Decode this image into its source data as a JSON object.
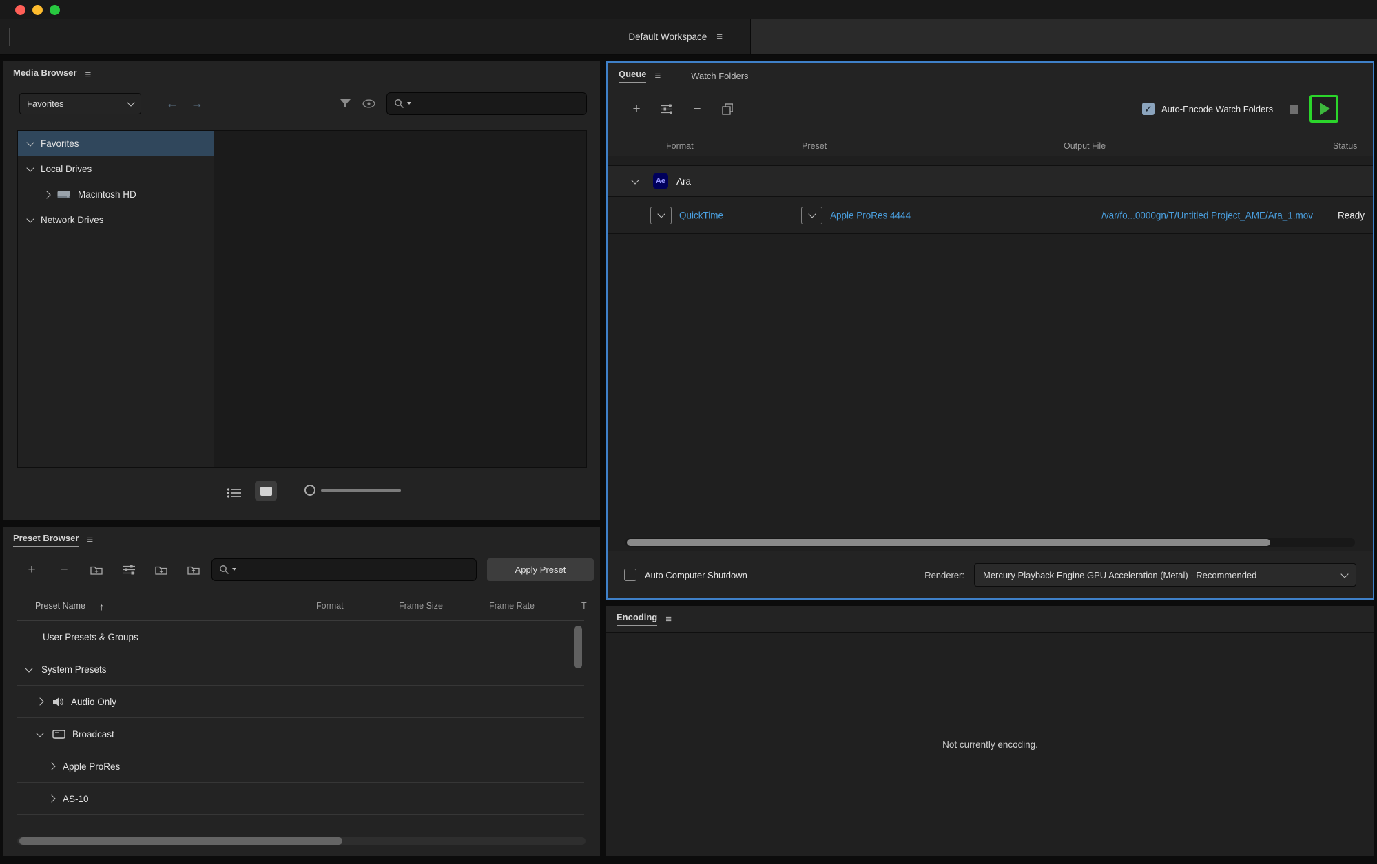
{
  "colors": {
    "link_blue": "#4aa0e0",
    "panel_focus_border": "#3f80c8",
    "highlight_green": "#2bd52b",
    "tree_selection_blue": "#30475c",
    "ae_badge_bg": "#00005b",
    "ae_badge_text": "#9999ff"
  },
  "icons": {
    "hamburger": "≡",
    "back_arrow": "←",
    "forward_arrow": "→",
    "plus": "+",
    "minus": "−",
    "sort_ascending": "↑",
    "check": "✓"
  },
  "workspace": {
    "label": "Default Workspace"
  },
  "media_browser": {
    "title": "Media Browser",
    "location_dropdown": {
      "value": "Favorites"
    },
    "tree": {
      "items": [
        {
          "label": "Favorites"
        },
        {
          "label": "Local Drives"
        },
        {
          "label": "Macintosh HD"
        },
        {
          "label": "Network Drives"
        }
      ]
    }
  },
  "preset_browser": {
    "title": "Preset Browser",
    "apply_button_label": "Apply Preset",
    "columns": {
      "name": "Preset Name",
      "format": "Format",
      "frame_size": "Frame Size",
      "frame_rate": "Frame Rate",
      "target": "T"
    },
    "rows": [
      {
        "label": "User Presets & Groups"
      },
      {
        "label": "System Presets"
      },
      {
        "label": "Audio Only"
      },
      {
        "label": "Broadcast"
      },
      {
        "label": "Apple ProRes"
      },
      {
        "label": "AS-10"
      }
    ]
  },
  "queue": {
    "tabs": {
      "queue": "Queue",
      "watch_folders": "Watch Folders"
    },
    "auto_encode_label": "Auto-Encode Watch Folders",
    "columns": {
      "format": "Format",
      "preset": "Preset",
      "output_file": "Output File",
      "status": "Status"
    },
    "group": {
      "badge": "Ae",
      "name": "Ara"
    },
    "item": {
      "format": "QuickTime",
      "preset": "Apple ProRes 4444",
      "output_file": "/var/fo...0000gn/T/Untitled Project_AME/Ara_1.mov",
      "status": "Ready"
    },
    "auto_shutdown_label": "Auto Computer Shutdown",
    "renderer_label": "Renderer:",
    "renderer_value": "Mercury Playback Engine GPU Acceleration (Metal) - Recommended"
  },
  "encoding": {
    "title": "Encoding",
    "status_text": "Not currently encoding."
  }
}
